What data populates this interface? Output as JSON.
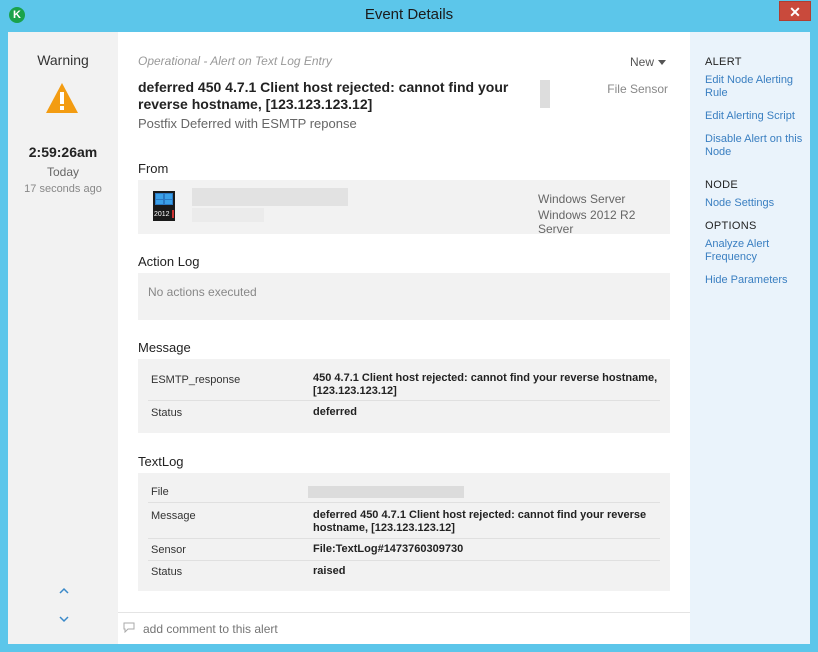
{
  "window": {
    "title": "Event Details",
    "close_label": "✕"
  },
  "left": {
    "severity": "Warning",
    "time": "2:59:26am",
    "day": "Today",
    "ago": "17 seconds ago",
    "nav_up": "⌃",
    "nav_down": "⌄"
  },
  "event": {
    "subtitle": "Operational - Alert on Text Log Entry",
    "state": "New",
    "headline": "deferred 450 4.7.1 Client host rejected: cannot find your reverse hostname, [123.123.123.12]",
    "sensor": "File Sensor",
    "description": "Postfix Deferred with ESMTP reponse"
  },
  "from": {
    "heading": "From",
    "os_line1": "Windows Server",
    "os_line2": "Windows 2012 R2 Server",
    "badge": "2012"
  },
  "action_log": {
    "heading": "Action Log",
    "empty": "No actions executed"
  },
  "message": {
    "heading": "Message",
    "rows": [
      {
        "key": "ESMTP_response",
        "value": "450 4.7.1 Client host rejected: cannot find your reverse hostname, [123.123.123.12]"
      },
      {
        "key": "Status",
        "value": "deferred"
      }
    ]
  },
  "textlog": {
    "heading": "TextLog",
    "rows": [
      {
        "key": "File",
        "value": ""
      },
      {
        "key": "Message",
        "value": "deferred 450 4.7.1 Client host rejected: cannot find your reverse hostname, [123.123.123.12]"
      },
      {
        "key": "Sensor",
        "value": "File:TextLog#1473760309730"
      },
      {
        "key": "Status",
        "value": "raised"
      }
    ]
  },
  "comment": {
    "placeholder": "add comment to this alert"
  },
  "right": {
    "alert_heading": "ALERT",
    "edit_rule": "Edit Node Alerting Rule",
    "edit_script": "Edit Alerting Script",
    "disable_alert": "Disable Alert on this Node",
    "node_heading": "NODE",
    "node_settings": "Node Settings",
    "options_heading": "OPTIONS",
    "analyze": "Analyze Alert Frequency",
    "hide_params": "Hide Parameters"
  },
  "colors": {
    "titlebar": "#5cc6ea",
    "link": "#3a7fc1",
    "warning": "#f39c12"
  }
}
